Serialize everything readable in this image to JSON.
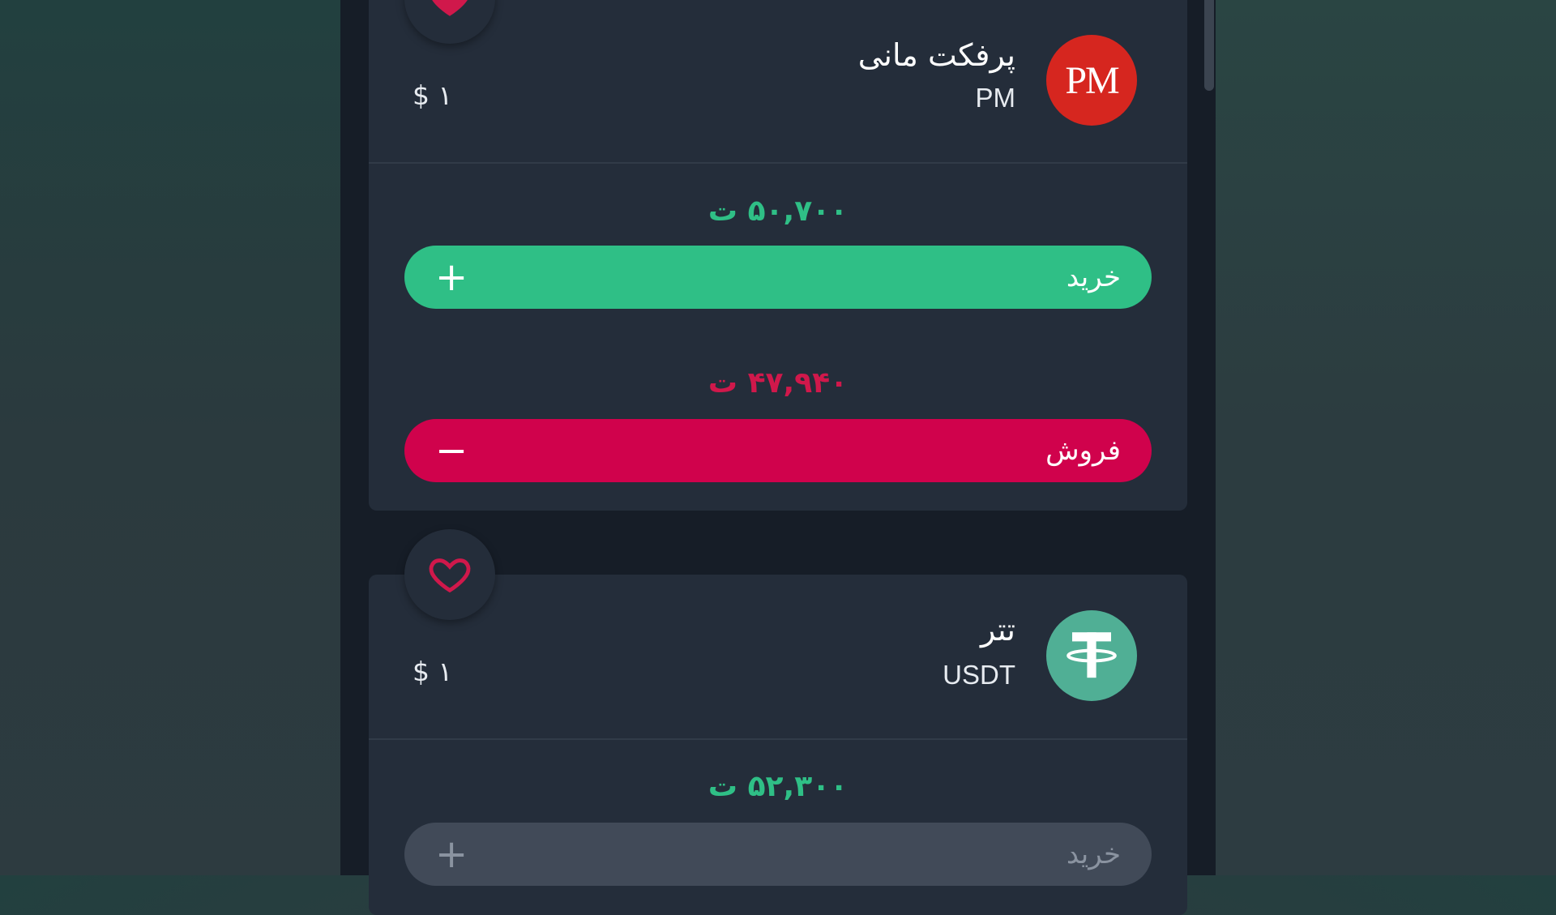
{
  "colors": {
    "buy": "#2fbf86",
    "sell": "#d0024c",
    "disabled": "#414a58",
    "card": "#242d3a",
    "pm_logo": "#d6261f",
    "usdt_logo": "#50af95"
  },
  "items": [
    {
      "name": "پرفکت مانی",
      "symbol": "PM",
      "logo_text": "PM",
      "logo_icon": "perfect-money-logo",
      "unit_price": "$ ۱",
      "favorite_icon": "heart-filled-icon",
      "buy_price": "۵۰,۷۰۰  ت",
      "buy_label": "خرید",
      "buy_icon": "+",
      "sell_price": "۴۷,۹۴۰  ت",
      "sell_label": "فروش",
      "sell_icon": "−"
    },
    {
      "name": "تتر",
      "symbol": "USDT",
      "logo_icon": "tether-logo",
      "unit_price": "$ ۱",
      "favorite_icon": "heart-outline-icon",
      "buy_price": "۵۲,۳۰۰  ت",
      "buy_label": "خرید",
      "buy_icon": "+",
      "buy_disabled": true
    }
  ]
}
